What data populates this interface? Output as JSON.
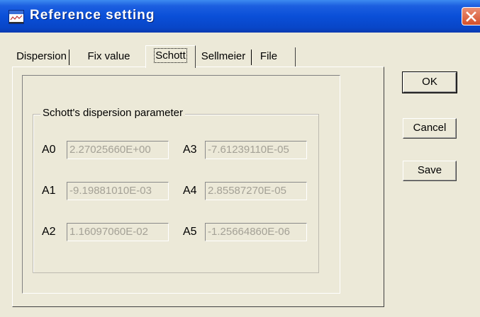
{
  "window": {
    "title": "Reference setting"
  },
  "tabs": [
    {
      "label": "Dispersion"
    },
    {
      "label": "Fix value"
    },
    {
      "label": "Schott",
      "active": true
    },
    {
      "label": "Sellmeier"
    },
    {
      "label": "File"
    }
  ],
  "group": {
    "title": "Schott's dispersion parameter"
  },
  "params": [
    {
      "label": "A0",
      "value": "2.27025660E+00"
    },
    {
      "label": "A1",
      "value": "-9.19881010E-03"
    },
    {
      "label": "A2",
      "value": "1.16097060E-02"
    },
    {
      "label": "A3",
      "value": "-7.61239110E-05"
    },
    {
      "label": "A4",
      "value": "2.85587270E-05"
    },
    {
      "label": "A5",
      "value": "-1.25664860E-06"
    }
  ],
  "buttons": {
    "ok": "OK",
    "cancel": "Cancel",
    "save": "Save"
  },
  "icons": {
    "app": "chart-window-icon",
    "close": "close-icon"
  },
  "colors": {
    "titlebar": "#0a4fd8",
    "close": "#d4502a",
    "face": "#ece9d8",
    "disabled_text": "#a4a196"
  }
}
